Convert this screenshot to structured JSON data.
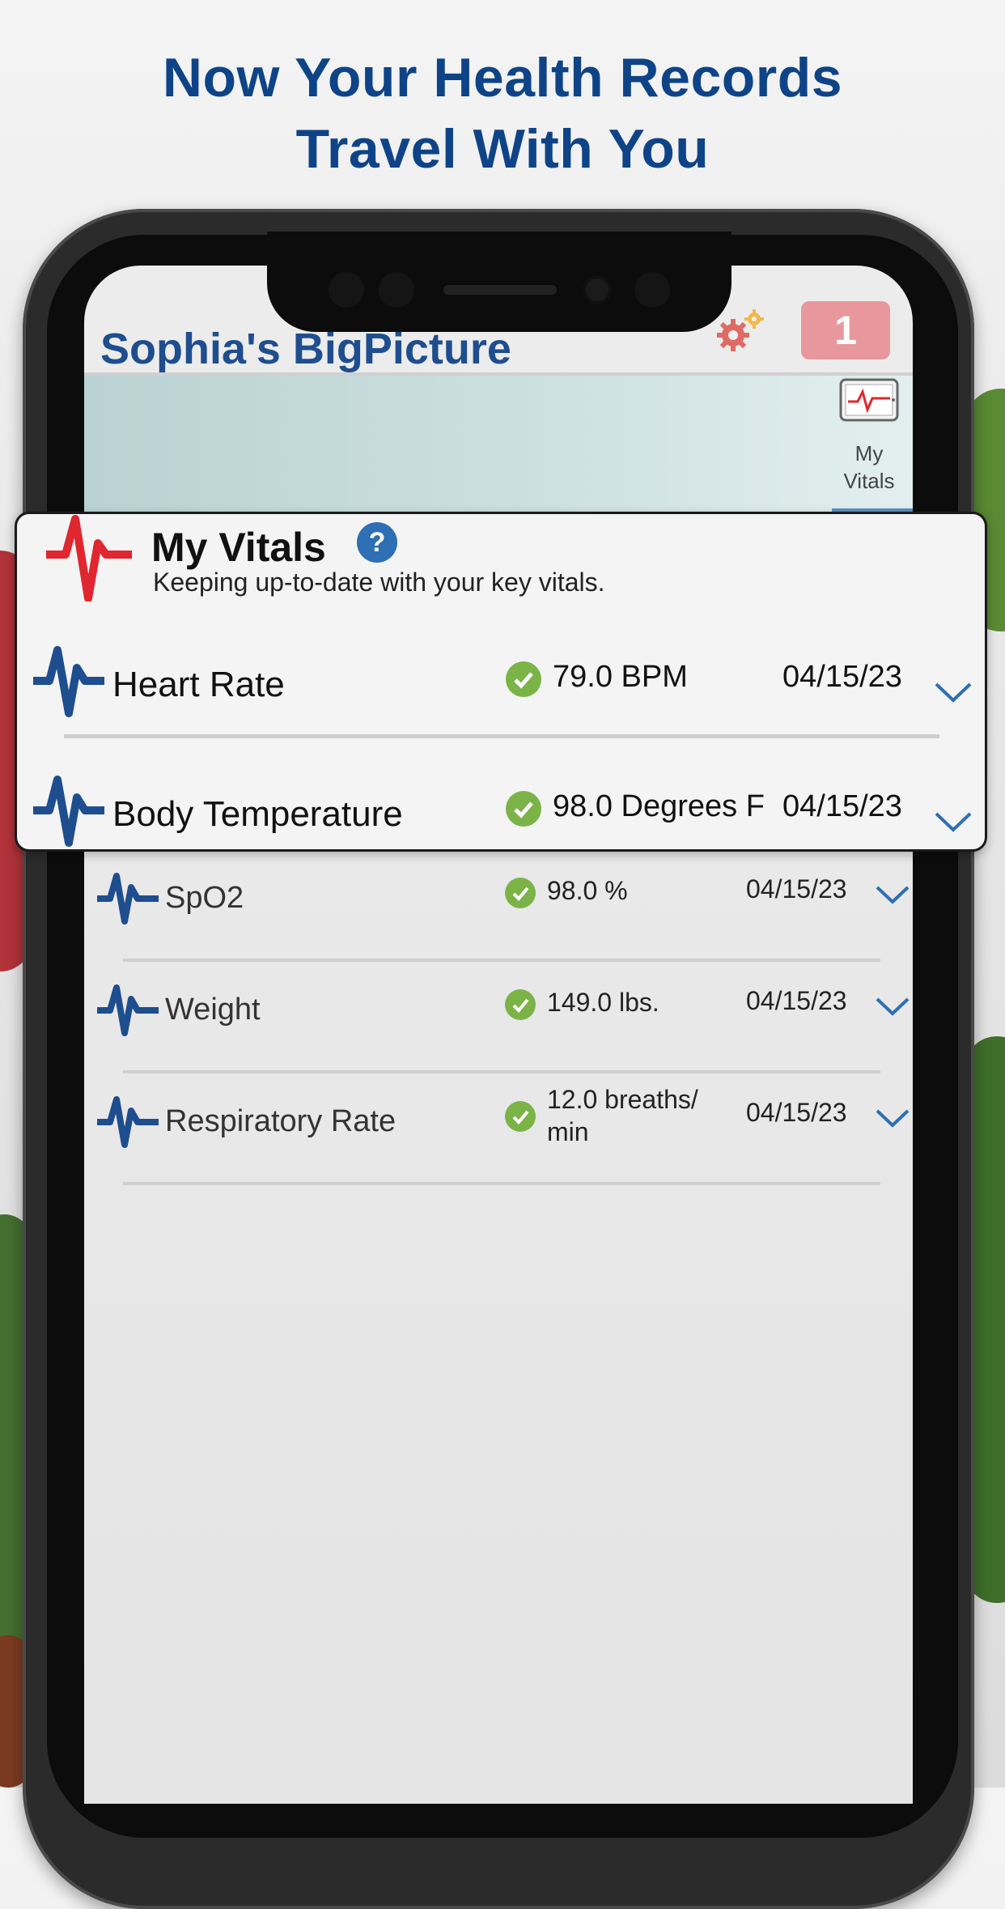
{
  "headline": {
    "line1": "Now Your Health Records",
    "line2": "Travel With You"
  },
  "app": {
    "title": "Sophia's BigPicture",
    "notification_count": "1",
    "settings_icon": "gear-icon",
    "accent": "#1f4e8f"
  },
  "tabs": [
    {
      "label_line1": "My",
      "label_line2": "Vitals",
      "icon": "tablet-vitals-icon"
    }
  ],
  "vitals_card": {
    "title": "My Vitals",
    "help": "?",
    "subtitle": "Keeping up-to-date with your key vitals.",
    "rows": [
      {
        "label": "Heart Rate",
        "value": "79.0 BPM",
        "date": "04/15/23"
      },
      {
        "label": "Body Temperature",
        "value": "98.0 Degrees F",
        "date": "04/15/23"
      }
    ]
  },
  "vitals_list": [
    {
      "label": "SpO2",
      "value": "98.0 %",
      "date": "04/15/23"
    },
    {
      "label": "Weight",
      "value": "149.0 lbs.",
      "date": "04/15/23"
    },
    {
      "label": "Respiratory Rate",
      "value_line1": "12.0 breaths/",
      "value_line2": "min",
      "date": "04/15/23"
    }
  ],
  "colors": {
    "status_ok": "#7bb347",
    "chevron": "#2e6fb5",
    "pulse_blue": "#1f4e8f",
    "pulse_red": "#e0262e",
    "badge": "#e88f95"
  }
}
